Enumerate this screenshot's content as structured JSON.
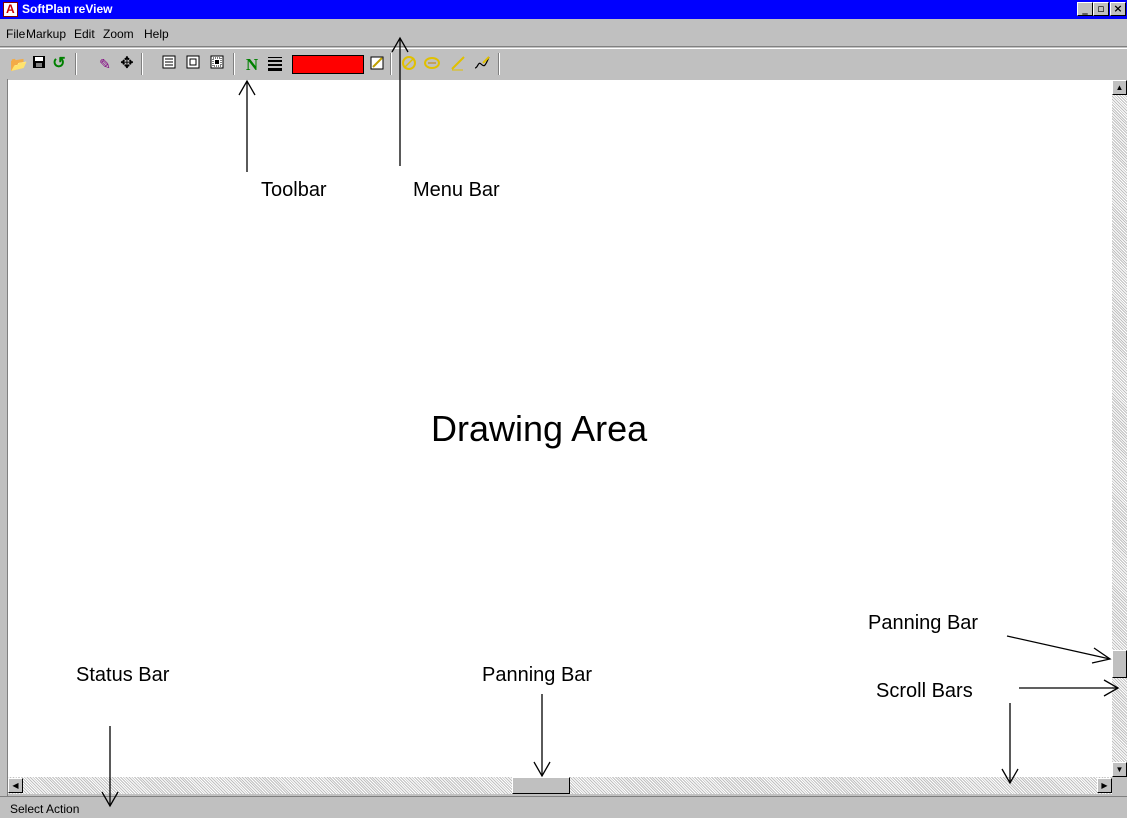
{
  "window": {
    "title": "SoftPlan reView",
    "controls": {
      "minimize": "_",
      "maximize": "▫",
      "close": "×"
    }
  },
  "menu": [
    "File",
    "Markup",
    "Edit",
    "Zoom",
    "Help"
  ],
  "toolbar": {
    "icons": [
      "open-folder-icon",
      "save-disk-icon",
      "undo-arrow-icon",
      "eraser-brush-icon",
      "move-cross-icon",
      "view-page-icon",
      "zoom-box-icon",
      "zoom-extents-icon",
      "north-icon",
      "line-weight-icon",
      "edit-note-icon",
      "circle-markup-icon",
      "cloud-markup-icon",
      "pencil-markup-icon",
      "freehand-markup-icon"
    ],
    "north_label": "N",
    "markup_color": "#ff0000"
  },
  "annotations": {
    "toolbar": "Toolbar",
    "menu_bar": "Menu Bar",
    "drawing_area": "Drawing Area",
    "panning_bar_right": "Panning Bar",
    "panning_bar_bottom": "Panning Bar",
    "scroll_bars": "Scroll Bars",
    "status_bar": "Status Bar"
  },
  "status": {
    "text": "Select Action"
  },
  "colors": {
    "title_bar": "#0000ff",
    "chrome": "#c0c0c0"
  }
}
